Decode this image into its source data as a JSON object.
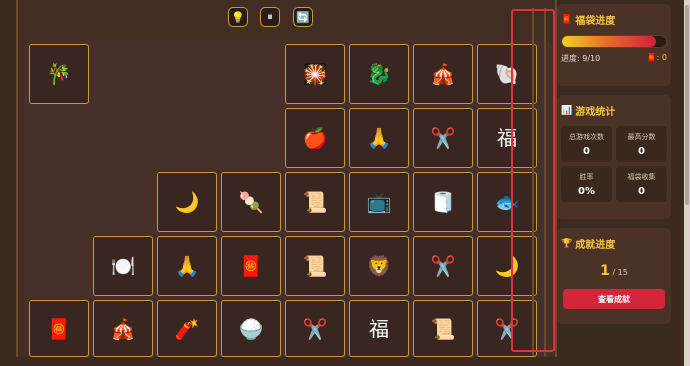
{
  "toolbar": {
    "hint_icon": "💡",
    "pause_icon": "⏸",
    "shuffle_icon": "🔄"
  },
  "board": {
    "tiles": [
      {
        "e": "🎋"
      },
      {
        "e": "🎇"
      },
      {
        "e": "🐉"
      },
      {
        "e": "🎪"
      },
      {
        "e": "🐚"
      },
      {
        "e": "🍎"
      },
      {
        "e": "🙏"
      },
      {
        "e": "✂️"
      },
      {
        "e": "福"
      },
      {
        "e": "🌙"
      },
      {
        "e": "🍡"
      },
      {
        "e": "📜"
      },
      {
        "e": "📺"
      },
      {
        "e": "🧻"
      },
      {
        "e": "🐟"
      },
      {
        "e": "🍽️"
      },
      {
        "e": "🙏"
      },
      {
        "e": "🧧"
      },
      {
        "e": "📜"
      },
      {
        "e": "🦁"
      },
      {
        "e": "✂️"
      },
      {
        "e": "🌙"
      },
      {
        "e": "🧧"
      },
      {
        "e": "🎪"
      },
      {
        "e": "🧨"
      },
      {
        "e": "🍚"
      },
      {
        "e": "✂️"
      },
      {
        "e": "福"
      },
      {
        "e": "📜"
      },
      {
        "e": "✂️"
      }
    ]
  },
  "progress_panel": {
    "icon": "🧧",
    "title": "福袋进度",
    "progress_text": "进度: 9/10",
    "progress_fraction": 0.9,
    "bag_icon": "🧧",
    "bag_count": "0"
  },
  "stats_panel": {
    "icon": "📊",
    "title": "游戏统计",
    "stats": [
      {
        "label": "总游戏次数",
        "value": "0"
      },
      {
        "label": "最高分数",
        "value": "0"
      },
      {
        "label": "胜率",
        "value": "0%"
      },
      {
        "label": "福袋收集",
        "value": "0"
      }
    ]
  },
  "achievement_panel": {
    "icon": "🏆",
    "title": "成就进度",
    "current": "1",
    "total": "/ 15",
    "button_label": "查看成就"
  },
  "colors": {
    "background": "#3b2a20",
    "tile_border": "#c59b3b",
    "accent_gold": "#f5c542",
    "accent_red": "#d4263b",
    "selection": "#e0323c"
  }
}
